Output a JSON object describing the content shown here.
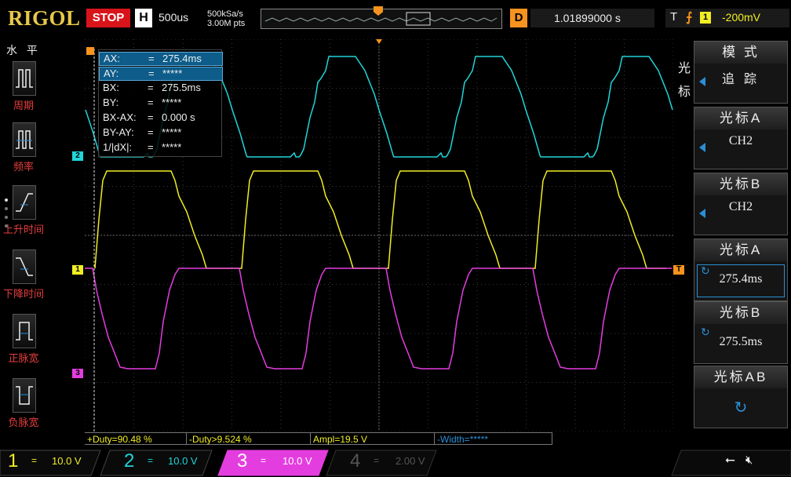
{
  "topbar": {
    "brand": "RIGOL",
    "run_status": "STOP",
    "horizontal_label": "H",
    "timebase": "500us",
    "sample_rate": "500kSa/s",
    "mem_depth": "3.00M pts",
    "delay_label": "D",
    "delay_value": "1.01899000 s",
    "trigger_label": "T",
    "trigger_channel": "1",
    "trigger_level": "-200mV"
  },
  "left_menu": {
    "title": "水 平",
    "items": [
      {
        "label": "周期",
        "icon": "period-icon"
      },
      {
        "label": "频率",
        "icon": "frequency-icon"
      },
      {
        "label": "上升时间",
        "icon": "rise-time-icon"
      },
      {
        "label": "下降时间",
        "icon": "fall-time-icon"
      },
      {
        "label": "正脉宽",
        "icon": "positive-width-icon"
      },
      {
        "label": "负脉宽",
        "icon": "negative-width-icon"
      }
    ]
  },
  "cursor_readout": {
    "rows": [
      {
        "key": "AX:",
        "eq": "=",
        "val": "275.4ms"
      },
      {
        "key": "AY:",
        "eq": "=",
        "val": "*****"
      },
      {
        "key": "BX:",
        "eq": "=",
        "val": "275.5ms"
      },
      {
        "key": "BY:",
        "eq": "=",
        "val": "*****"
      },
      {
        "key": "BX-AX:",
        "eq": "=",
        "val": "0.000 s"
      },
      {
        "key": "BY-AY:",
        "eq": "=",
        "val": "*****"
      },
      {
        "key": "1/|dX|:",
        "eq": "=",
        "val": "*****"
      }
    ]
  },
  "right_menu": {
    "side_label_1": "光",
    "side_label_2": "标",
    "buttons": [
      {
        "title": "模 式",
        "value": "追 踪"
      },
      {
        "title": "光标A",
        "value": "CH2"
      },
      {
        "title": "光标B",
        "value": "CH2"
      },
      {
        "title": "光标A",
        "value": "275.4ms"
      },
      {
        "title": "光标B",
        "value": "275.5ms"
      },
      {
        "title": "光标AB",
        "value": ""
      }
    ]
  },
  "measurements": {
    "duty_pos": "+Duty=90.48 %",
    "duty_neg": "-Duty>9.524 %",
    "ampl": "Ampl=19.5 V",
    "width_neg": "-Width=*****"
  },
  "channels": [
    {
      "num": "1",
      "coupling": "=",
      "scale": "10.0 V",
      "color": "#f1ee24"
    },
    {
      "num": "2",
      "coupling": "=",
      "scale": "10.0 V",
      "color": "#1fd6d9"
    },
    {
      "num": "3",
      "coupling": "=",
      "scale": "10.0 V",
      "color": "#e43ddf"
    },
    {
      "num": "4",
      "coupling": "=",
      "scale": "2.00 V",
      "color": "#555555"
    }
  ],
  "colors": {
    "ch1": "#f1ee24",
    "ch2": "#1fd6d9",
    "ch3": "#e43ddf",
    "trigger": "#f7931e",
    "accent": "#2a8fd6"
  }
}
